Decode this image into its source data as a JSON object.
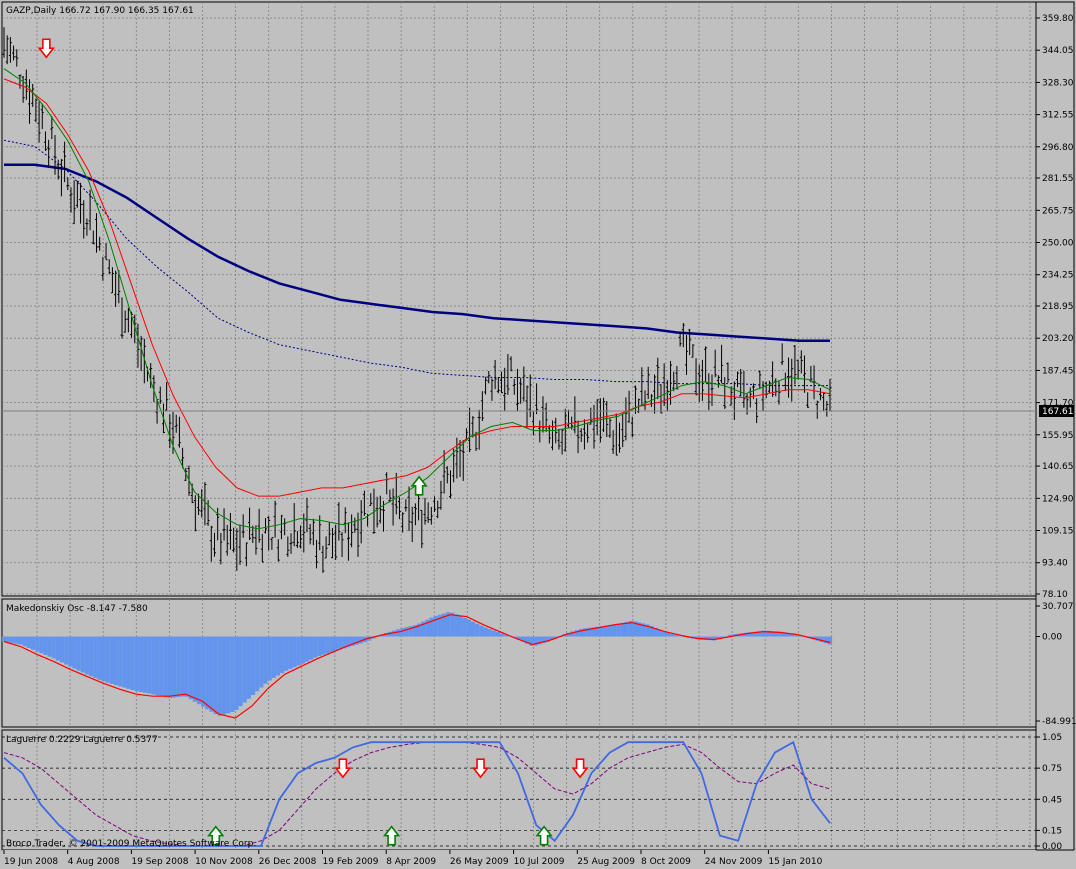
{
  "colors": {
    "background": "#c0c0c0",
    "grid": "#808080",
    "bars": "#000000",
    "ma_fast": "#008000",
    "ma_mid": "#ff0000",
    "ma_slow": "#000080",
    "ma_slow_dotted": "#000080",
    "osc_hist": "#6495ed",
    "osc_signal": "#ff0000",
    "laguerre_main": "#4169e1",
    "laguerre_signal": "#800080",
    "arrow_up": "#008000",
    "arrow_down": "#ff0000",
    "price_tag_bg": "#000000",
    "price_tag_fg": "#ffffff"
  },
  "main_panel": {
    "header": "GAZP,Daily  166.72 167.90 166.35 167.61",
    "current_price_label": "167.61"
  },
  "osc_panel": {
    "header": "Makedonskiy  Osc -8.147 -7.580"
  },
  "laguerre_panel": {
    "header": "Laguerre 0.2229  Laguerre 0.5377",
    "watermark": "Broco Trader, © 2001-2009 MetaQuotes Software Corp."
  },
  "x_axis_dates": [
    "19 Jun 2008",
    "4 Aug 2008",
    "19 Sep 2008",
    "10 Nov 2008",
    "26 Dec 2008",
    "19 Feb 2009",
    "8 Apr 2009",
    "26 May 2009",
    "10 Jul 2009",
    "25 Aug 2009",
    "8 Oct 2009",
    "24 Nov 2009",
    "15 Jan 2010"
  ],
  "chart_data": [
    {
      "type": "line",
      "title": "GAZP,Daily",
      "series": [
        {
          "name": "price",
          "x": [
            0,
            10,
            20,
            30,
            40,
            50,
            60,
            70,
            80,
            90,
            100,
            110,
            120,
            130,
            140,
            150,
            160,
            170,
            180,
            190,
            200,
            210,
            220,
            230,
            240,
            250,
            260,
            270,
            280,
            290,
            300,
            310,
            320,
            330,
            340,
            350,
            360,
            370,
            380,
            390
          ],
          "values": [
            348,
            330,
            305,
            278,
            265,
            235,
            210,
            180,
            160,
            125,
            105,
            102,
            110,
            108,
            113,
            102,
            106,
            120,
            125,
            113,
            120,
            135,
            150,
            185,
            182,
            170,
            150,
            158,
            165,
            155,
            172,
            178,
            197,
            185,
            183,
            170,
            178,
            190,
            180,
            167
          ]
        },
        {
          "name": "MA fast",
          "values": [
            335,
            328,
            315,
            300,
            280,
            250,
            215,
            180,
            150,
            128,
            118,
            112,
            110,
            112,
            115,
            114,
            112,
            115,
            122,
            128,
            135,
            145,
            155,
            160,
            162,
            158,
            158,
            160,
            163,
            165,
            170,
            175,
            180,
            182,
            180,
            176,
            180,
            184,
            183,
            178
          ]
        },
        {
          "name": "MA mid",
          "values": [
            330,
            326,
            318,
            303,
            285,
            260,
            230,
            200,
            175,
            155,
            140,
            130,
            126,
            126,
            128,
            130,
            130,
            132,
            134,
            136,
            140,
            148,
            155,
            158,
            160,
            160,
            160,
            162,
            164,
            166,
            170,
            172,
            176,
            176,
            175,
            174,
            176,
            178,
            178,
            176
          ]
        },
        {
          "name": "MA slow",
          "values": [
            288,
            288,
            286,
            280,
            272,
            262,
            252,
            243,
            236,
            230,
            226,
            222,
            220,
            218,
            216,
            215,
            213,
            212,
            211,
            210,
            209,
            208,
            206,
            205,
            204,
            203,
            202,
            202
          ]
        },
        {
          "name": "MA slow dotted",
          "values": [
            300,
            297,
            286,
            270,
            252,
            238,
            226,
            213,
            206,
            200,
            197,
            194,
            191,
            189,
            186,
            185,
            184,
            184,
            183,
            183,
            182,
            182,
            181,
            181,
            181,
            180,
            180,
            180
          ]
        }
      ],
      "ylim": [
        78.1,
        359.8
      ],
      "yticks": [
        "359.80",
        "344.05",
        "328.30",
        "312.55",
        "296.80",
        "281.55",
        "265.75",
        "250.00",
        "234.25",
        "218.95",
        "203.20",
        "187.45",
        "171.70",
        "155.95",
        "140.65",
        "124.90",
        "109.15",
        "93.40",
        "78.10"
      ],
      "arrows": [
        {
          "dir": "down",
          "x": 20,
          "y": 345
        },
        {
          "dir": "up",
          "x": 196,
          "y": 131
        }
      ]
    },
    {
      "type": "bar",
      "title": "Makedonskiy Osc",
      "values": [
        -5,
        -8,
        -15,
        -22,
        -30,
        -38,
        -45,
        -50,
        -55,
        -58,
        -62,
        -60,
        -70,
        -80,
        -75,
        -60,
        -45,
        -35,
        -28,
        -20,
        -15,
        -10,
        -5,
        3,
        8,
        12,
        20,
        25,
        18,
        10,
        4,
        -2,
        -10,
        -5,
        3,
        8,
        10,
        12,
        16,
        12,
        5,
        0,
        -3,
        -4,
        2,
        4,
        6,
        5,
        2,
        -3,
        -8
      ],
      "signal": [
        -5,
        -10,
        -18,
        -25,
        -33,
        -40,
        -47,
        -53,
        -58,
        -60,
        -60,
        -58,
        -65,
        -78,
        -82,
        -70,
        -52,
        -38,
        -30,
        -22,
        -15,
        -8,
        -2,
        2,
        5,
        10,
        16,
        22,
        20,
        12,
        5,
        -2,
        -8,
        -4,
        2,
        6,
        9,
        12,
        14,
        10,
        5,
        1,
        -2,
        -3,
        0,
        3,
        5,
        4,
        2,
        -2,
        -6
      ],
      "yticks": [
        "30.707",
        "0.00",
        "-84.991"
      ],
      "ylim": [
        -84.991,
        30.707
      ]
    },
    {
      "type": "line",
      "title": "Laguerre",
      "series": [
        {
          "name": "Laguerre main",
          "values": [
            0.85,
            0.7,
            0.4,
            0.2,
            0.05,
            0.0,
            0.0,
            0.0,
            0.0,
            0.0,
            0.0,
            0.0,
            0.0,
            0.0,
            0.0,
            0.45,
            0.7,
            0.8,
            0.85,
            0.95,
            1.0,
            1.0,
            1.0,
            1.0,
            1.0,
            1.0,
            1.0,
            1.0,
            0.7,
            0.2,
            0.05,
            0.3,
            0.7,
            0.9,
            1.0,
            1.0,
            1.0,
            1.0,
            0.7,
            0.1,
            0.05,
            0.6,
            0.9,
            1.0,
            0.45,
            0.22
          ]
        },
        {
          "name": "Laguerre signal",
          "values": [
            0.9,
            0.85,
            0.75,
            0.6,
            0.45,
            0.3,
            0.2,
            0.1,
            0.05,
            0.02,
            0.0,
            0.0,
            0.0,
            0.0,
            0.05,
            0.15,
            0.35,
            0.55,
            0.7,
            0.82,
            0.9,
            0.95,
            0.98,
            1.0,
            1.0,
            1.0,
            0.98,
            0.95,
            0.85,
            0.7,
            0.55,
            0.5,
            0.6,
            0.75,
            0.85,
            0.9,
            0.95,
            0.98,
            0.9,
            0.75,
            0.62,
            0.6,
            0.7,
            0.78,
            0.6,
            0.55
          ]
        }
      ],
      "yticks": [
        "1.05",
        "0.75",
        "0.45",
        "0.15",
        "0.00"
      ],
      "ylim": [
        0.0,
        1.05
      ],
      "arrows": [
        {
          "dir": "down",
          "x": 160,
          "y": 0.75
        },
        {
          "dir": "down",
          "x": 225,
          "y": 0.75
        },
        {
          "dir": "down",
          "x": 272,
          "y": 0.75
        },
        {
          "dir": "up",
          "x": 100,
          "y": 0.1
        },
        {
          "dir": "up",
          "x": 183,
          "y": 0.1
        },
        {
          "dir": "up",
          "x": 255,
          "y": 0.1
        }
      ]
    }
  ]
}
